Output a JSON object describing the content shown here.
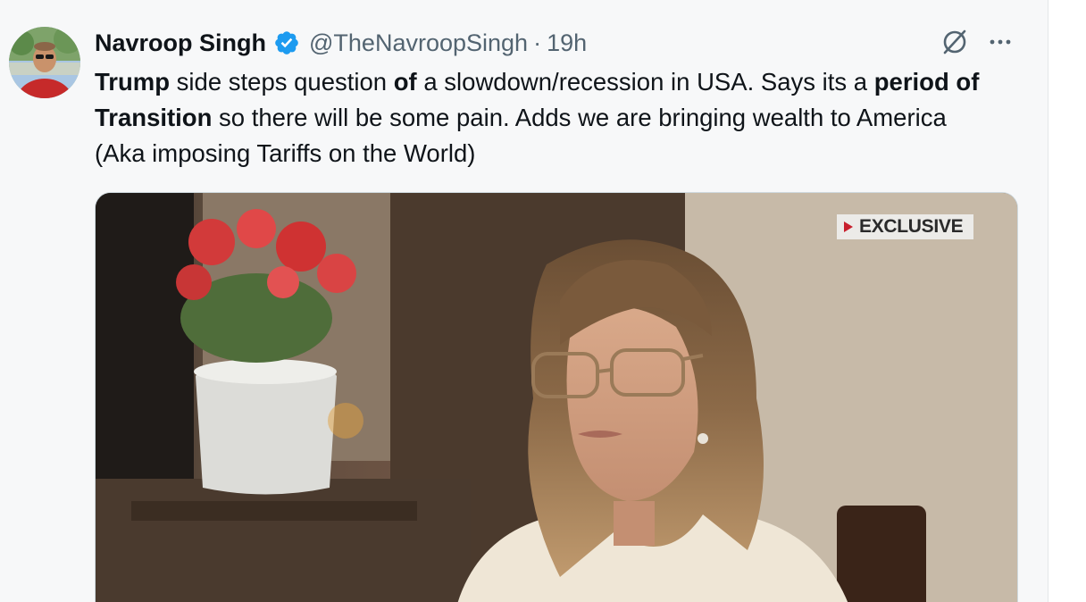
{
  "tweet": {
    "author": {
      "display_name": "Navroop Singh",
      "handle": "@TheNavroopSingh",
      "verified": true,
      "avatar_icon": "user-avatar"
    },
    "separator": "·",
    "time": "19h",
    "actions": {
      "grok_icon": "grok-icon",
      "more_icon": "more-options-icon"
    },
    "text_segments": [
      {
        "text": "Trump",
        "bold": true
      },
      {
        "text": " side steps question ",
        "bold": false
      },
      {
        "text": "of",
        "bold": true
      },
      {
        "text": " a slowdown/recession in USA. Says its a ",
        "bold": false
      },
      {
        "text": "period of Transition",
        "bold": true
      },
      {
        "text": " so there will be some pain. Adds we are bringing wealth to America (Aka imposing Tariffs on the World)",
        "bold": false
      }
    ],
    "media": {
      "type": "video-still",
      "badge_label": "EXCLUSIVE"
    }
  },
  "colors": {
    "verified_blue": "#1d9bf0",
    "secondary_text": "#536471",
    "badge_red": "#c8202d"
  }
}
